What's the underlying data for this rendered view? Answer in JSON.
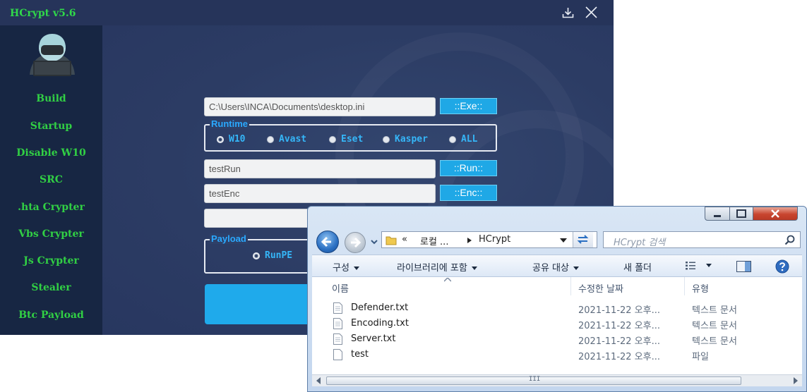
{
  "hcrypt": {
    "title": "HCrypt v5.6",
    "nav": [
      "Build",
      "Startup",
      "Disable W10",
      "SRC",
      ".hta Crypter",
      "Vbs Crypter",
      "Js Crypter",
      "Stealer",
      "Btc Payload"
    ],
    "exe_path": "C:\\Users\\INCA\\Documents\\desktop.ini",
    "exe_button": "::Exe::",
    "runtime": {
      "legend": "Runtime",
      "options": [
        "W10",
        "Avast",
        "Eset",
        "Kasper",
        "ALL"
      ],
      "selected": "W10"
    },
    "run_field": "testRun",
    "run_button": "::Run::",
    "enc_field": "testEnc",
    "enc_button": "::Enc::",
    "extra_field": "",
    "payload": {
      "legend": "Payload",
      "option": "RunPE",
      "selected": "RunPE"
    },
    "icons": {
      "download": "download-icon",
      "close": "close-icon",
      "avatar": "hacker-avatar"
    },
    "colors": {
      "accent_green": "#30d84a",
      "button_blue": "#1fa8e6",
      "background": "#2b3a62"
    }
  },
  "explorer": {
    "breadcrumb": {
      "chevrons": "«",
      "parent": "로컬 ...",
      "current": "HCrypt"
    },
    "search_placeholder": "HCrypt 검색",
    "toolbar": {
      "organize": "구성",
      "include_in_library": "라이브러리에 포함",
      "share_with": "공유 대상",
      "new_folder": "새 폴더"
    },
    "columns": {
      "name": "이름",
      "date": "수정한 날짜",
      "type": "유형"
    },
    "files": [
      {
        "name": "Defender.txt",
        "date": "2021-11-22 오후...",
        "type": "텍스트 문서"
      },
      {
        "name": "Encoding.txt",
        "date": "2021-11-22 오후...",
        "type": "텍스트 문서"
      },
      {
        "name": "Server.txt",
        "date": "2021-11-22 오후...",
        "type": "텍스트 문서"
      },
      {
        "name": "test",
        "date": "2021-11-22 오후...",
        "type": "파일"
      }
    ],
    "scrollbar_grip": "III"
  }
}
